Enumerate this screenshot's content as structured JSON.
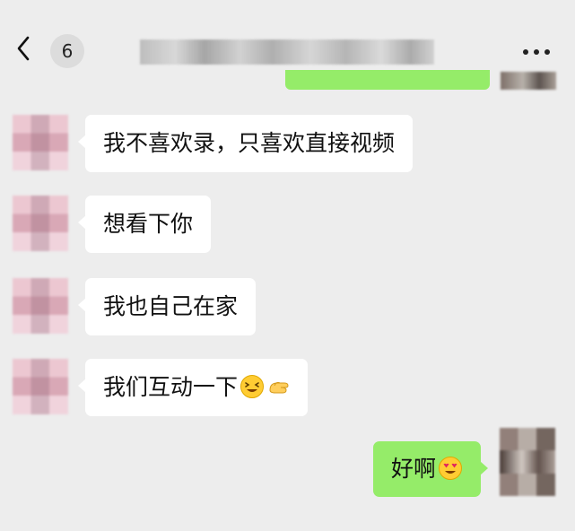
{
  "header": {
    "unread_count": "6"
  },
  "messages": [
    {
      "from": "other",
      "text": "我不喜欢录，只喜欢直接视频"
    },
    {
      "from": "other",
      "text": "想看下你"
    },
    {
      "from": "other",
      "text": "我也自己在家"
    },
    {
      "from": "other",
      "text": "我们互动一下",
      "emojis": [
        "grinning-squint-emoji",
        "beckoning-hand-emoji"
      ]
    },
    {
      "from": "me",
      "text": "好啊",
      "emojis": [
        "heart-eyes-emoji"
      ]
    }
  ],
  "colors": {
    "background": "#ededed",
    "other_bubble": "#ffffff",
    "my_bubble": "#95ec69"
  }
}
